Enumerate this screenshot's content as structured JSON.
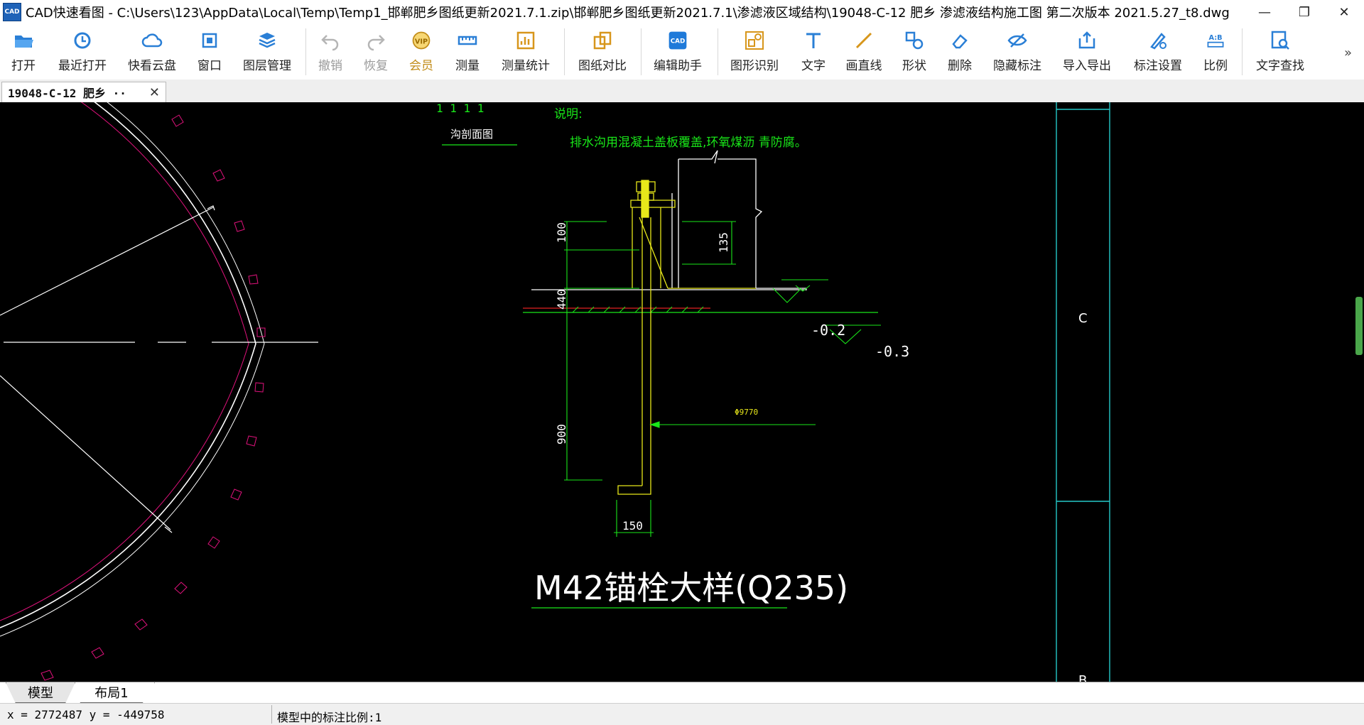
{
  "window": {
    "logo_text": "CAD",
    "title": "CAD快速看图 - C:\\Users\\123\\AppData\\Local\\Temp\\Temp1_邯郸肥乡图纸更新2021.7.1.zip\\邯郸肥乡图纸更新2021.7.1\\渗滤液区域结构\\19048-C-12   肥乡 渗滤液结构施工图 第二次版本 2021.5.27_t8.dwg",
    "controls": {
      "minimize": "—",
      "restore": "❐",
      "close": "✕"
    }
  },
  "toolbar": {
    "items": [
      {
        "label": "打开",
        "icon": "folder-open-icon"
      },
      {
        "label": "最近打开",
        "icon": "clock-history-icon"
      },
      {
        "label": "快看云盘",
        "icon": "cloud-icon"
      },
      {
        "label": "窗口",
        "icon": "window-icon"
      },
      {
        "label": "图层管理",
        "icon": "layers-icon"
      },
      {
        "label": "撤销",
        "icon": "undo-icon"
      },
      {
        "label": "恢复",
        "icon": "redo-icon"
      },
      {
        "label": "会员",
        "icon": "vip-badge-icon",
        "badge": "VIP"
      },
      {
        "label": "测量",
        "icon": "ruler-icon"
      },
      {
        "label": "测量统计",
        "icon": "measure-stats-icon"
      },
      {
        "label": "图纸对比",
        "icon": "compare-icon"
      },
      {
        "label": "编辑助手",
        "icon": "edit-assistant-icon",
        "badge": "CAD"
      },
      {
        "label": "图形识别",
        "icon": "shape-recognize-icon"
      },
      {
        "label": "文字",
        "icon": "text-icon"
      },
      {
        "label": "画直线",
        "icon": "line-icon"
      },
      {
        "label": "形状",
        "icon": "shapes-icon"
      },
      {
        "label": "删除",
        "icon": "eraser-icon"
      },
      {
        "label": "隐藏标注",
        "icon": "eye-hide-icon"
      },
      {
        "label": "导入导出",
        "icon": "import-export-icon"
      },
      {
        "label": "标注设置",
        "icon": "annotation-settings-icon"
      },
      {
        "label": "比例",
        "icon": "scale-icon",
        "badge": "A:B"
      },
      {
        "label": "文字查找",
        "icon": "text-search-icon"
      }
    ],
    "more": "»"
  },
  "tabs": {
    "doc_tab": "19048-C-12   肥乡 ··",
    "close": "✕"
  },
  "drawing": {
    "section_marks": "1 1    1 1",
    "note_title": "说明:",
    "section_label": "沟剖面图",
    "note_text": "排水沟用混凝土盖板覆盖,环氧煤沥        青防腐。",
    "dim_100": "100",
    "dim_440": "440",
    "dim_900": "900",
    "dim_135": "135",
    "dim_150": "150",
    "elev_1": "-0.2",
    "elev_2": "-0.3",
    "rebar_label": "Φ9770",
    "detail_title": "M42锚栓大样(Q235)",
    "grid_c": "C",
    "grid_b": "B"
  },
  "colors": {
    "canvas": "#000000",
    "green": "#19e619",
    "yellow": "#e8e81a",
    "white": "#ffffff",
    "magenta": "#e0127c",
    "red": "#e02020",
    "cyan": "#26c9c9"
  },
  "layout_tabs": {
    "model": "模型",
    "layout1": "布局1"
  },
  "status": {
    "coords": "x = 2772487  y = -449758",
    "scale": "模型中的标注比例:1"
  }
}
